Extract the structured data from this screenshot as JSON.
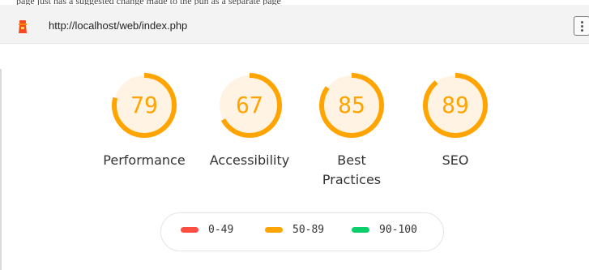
{
  "browser": {
    "url": "http://localhost/web/index.php",
    "top_text": "page just has a suggested change made to the pun as a separate page"
  },
  "colors": {
    "average": "#ffa400",
    "fail": "#ff4e42",
    "pass": "#0cce6b",
    "gauge_bg": "#fff4e3"
  },
  "scores": [
    {
      "value": "79",
      "label": "Performance"
    },
    {
      "value": "67",
      "label": "Accessibility"
    },
    {
      "value": "85",
      "label_line1": "Best",
      "label_line2": "Practices"
    },
    {
      "value": "89",
      "label": "SEO"
    }
  ],
  "legend": [
    {
      "range": "0-49",
      "color": "#ff4e42"
    },
    {
      "range": "50-89",
      "color": "#ffa400"
    },
    {
      "range": "90-100",
      "color": "#0cce6b"
    }
  ]
}
